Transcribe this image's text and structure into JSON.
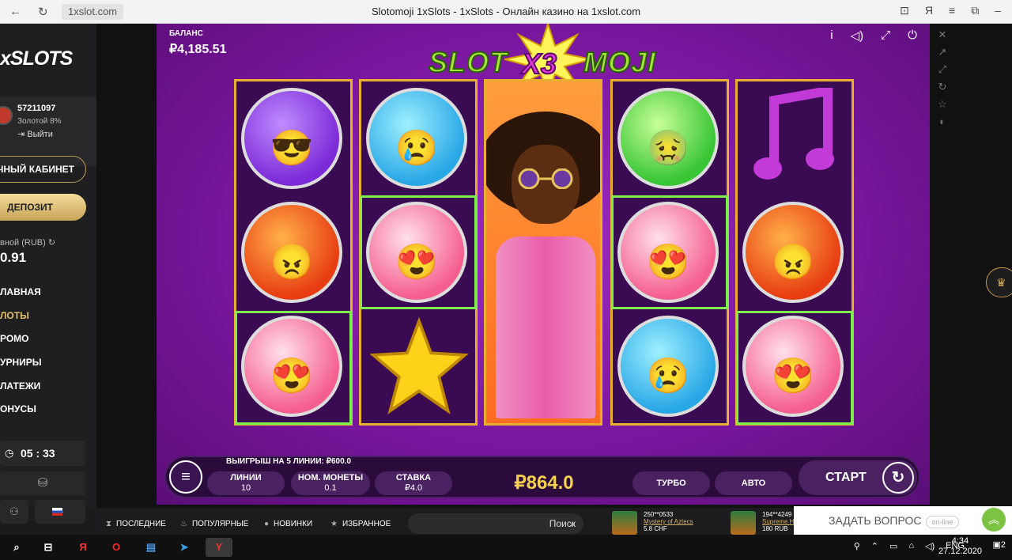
{
  "browser": {
    "url": "1xslot.com",
    "page_title": "Slotomoji 1xSlots - 1xSlots - Онлайн казино на 1xslot.com"
  },
  "sidebar": {
    "logo": "xSLOTS",
    "user_id": "57211097",
    "level": "Золотой 8%",
    "logout": "Выйти",
    "cabinet": "ЧНЫЙ КАБИНЕТ",
    "deposit": "ДЕПОЗИТ",
    "account_label": "вной (RUB)",
    "account_amount": "0.91",
    "nav": [
      {
        "label": "ЛАВНАЯ"
      },
      {
        "label": "ЛОТЫ"
      },
      {
        "label": "РОМО"
      },
      {
        "label": "УРНИРЫ"
      },
      {
        "label": "ЛАТЕЖИ"
      },
      {
        "label": "ОНУСЫ"
      }
    ],
    "clock": "05 : 33"
  },
  "game": {
    "balance_label": "БАЛАНС",
    "balance_value": "₽4,185.51",
    "title_left": "SLOT",
    "title_x3": "X3",
    "title_right": "MOJI",
    "win_text": "ВЫИГРЫШ НА 5 ЛИНИИ: ₽600.0",
    "lines_label": "ЛИНИИ",
    "lines_value": "10",
    "coin_label": "НОМ. МОНЕТЫ",
    "coin_value": "0.1",
    "bet_label": "СТАВКА",
    "bet_value": "₽4.0",
    "win_amount": "₽864.0",
    "turbo": "ТУРБО",
    "auto": "АВТО",
    "start": "СТАРТ",
    "reels": [
      [
        "purple-cool-emoji",
        "orange-angry-emoji",
        "pink-love-emoji"
      ],
      [
        "blue-sad-emoji",
        "pink-love-emoji",
        "yellow-star"
      ],
      [
        "afro-wild"
      ],
      [
        "green-sick-emoji",
        "pink-love-emoji",
        "blue-sad-emoji"
      ],
      [
        "purple-music-note",
        "orange-angry-emoji",
        "pink-love-emoji"
      ]
    ]
  },
  "bottom_nav": {
    "tabs": [
      "ПОСЛЕДНИЕ",
      "ПОПУЛЯРНЫЕ",
      "НОВИНКИ",
      "ИЗБРАННОЕ"
    ],
    "search_placeholder": "Поиск",
    "winners": [
      {
        "user": "250**0533",
        "game": "Mystery of Aztecs",
        "amount": "5.8 CHF"
      },
      {
        "user": "194**4249",
        "game": "Supreme H",
        "amount": "180 RUB"
      }
    ]
  },
  "support": {
    "ask": "ЗАДАТЬ ВОПРОС",
    "status": "on-line"
  },
  "taskbar": {
    "lang": "ENG",
    "time": "4:34",
    "date": "27.12.2020",
    "notifications": "2"
  }
}
